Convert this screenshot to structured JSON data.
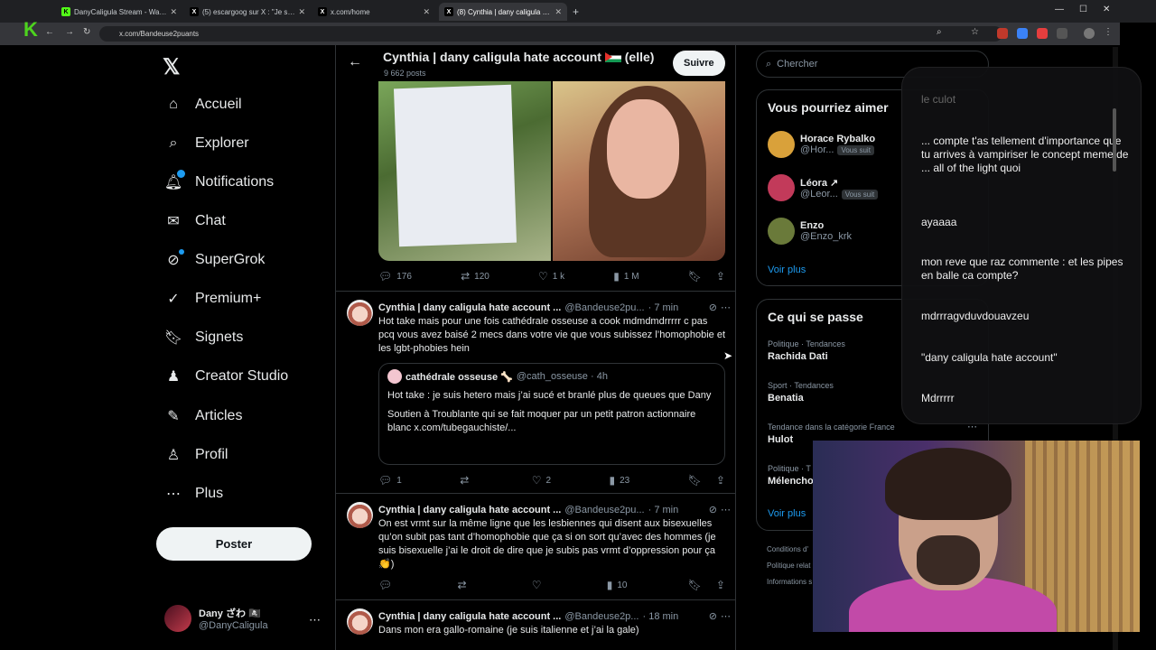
{
  "tabs": [
    {
      "label": "DanyCaligula Stream - Watch L",
      "fav": "K",
      "fav_color": "#53fc18"
    },
    {
      "label": "(5) escargoog sur X : \"Je suis pl",
      "fav": "X",
      "fav_color": "#ffffff"
    },
    {
      "label": "x.com/home",
      "fav": "X",
      "fav_color": "#ffffff"
    },
    {
      "label": "(8) Cynthia | dany caligula hate",
      "fav": "X",
      "fav_color": "#ffffff"
    }
  ],
  "url": "x.com/Bandeuse2puants",
  "nav": {
    "items": [
      {
        "label": "Accueil",
        "icon": "home-icon"
      },
      {
        "label": "Explorer",
        "icon": "search-icon"
      },
      {
        "label": "Notifications",
        "icon": "bell-icon"
      },
      {
        "label": "Chat",
        "icon": "mail-icon"
      },
      {
        "label": "SuperGrok",
        "icon": "grok-icon"
      },
      {
        "label": "Premium+",
        "icon": "verified-icon"
      },
      {
        "label": "Signets",
        "icon": "bookmark-icon"
      },
      {
        "label": "Creator Studio",
        "icon": "creator-icon"
      },
      {
        "label": "Articles",
        "icon": "articles-icon"
      },
      {
        "label": "Profil",
        "icon": "person-icon"
      },
      {
        "label": "Plus",
        "icon": "more-icon"
      }
    ],
    "post_label": "Poster",
    "me": {
      "name": "Dany ざわ 🏴‍☠️",
      "handle": "@DanyCaligula"
    }
  },
  "header": {
    "title": "Cynthia | dany caligula hate account",
    "title_suffix": "(elle)",
    "subtitle": "9 662 posts",
    "follow_label": "Suivre"
  },
  "first_tweet_actions": {
    "replies": "176",
    "reposts": "120",
    "likes": "1 k",
    "views": "1 M"
  },
  "tweets": [
    {
      "name": "Cynthia | dany caligula hate account ...",
      "handle": "@Bandeuse2pu...",
      "time": "· 7 min",
      "text": "Hot take mais pour une fois cathédrale osseuse a cook mdmdmdrrrrr c pas pcq vous avez baisé 2 mecs dans votre vie que vous subissez l’homophobie et les lgbt-phobies hein",
      "quote": {
        "name": "cathédrale osseuse 🦴",
        "handle": "@cath_osseuse · 4h",
        "text1": "Hot take : je suis hetero mais j’ai sucé et branlé plus de queues que Dany",
        "text2": "Soutien à Troublante qui se fait moquer par un petit patron actionnaire blanc x.com/tubegauchiste/..."
      },
      "replies": "1",
      "reposts": "",
      "likes": "2",
      "views": "23"
    },
    {
      "name": "Cynthia | dany caligula hate account ...",
      "handle": "@Bandeuse2pu...",
      "time": "· 7 min",
      "text": "On est vrmt sur la même ligne que les lesbiennes qui disent aux bisexuelles qu’on subit pas tant d’homophobie que ça si on sort qu’avec des hommes (je suis bisexuelle j’ai le droit de dire que je subis pas vrmt d’oppression pour ça 👏)",
      "replies": "",
      "reposts": "",
      "likes": "",
      "views": "10"
    },
    {
      "name": "Cynthia | dany caligula hate account ...",
      "handle": "@Bandeuse2p...",
      "time": "· 18 min",
      "text": "Dans mon era gallo-romaine (je suis italienne et j’ai la gale)"
    }
  ],
  "right": {
    "search_placeholder": "Chercher",
    "suggest_title": "Vous pourriez aimer",
    "suggestions": [
      {
        "name": "Horace Rybalko",
        "handle": "@Hor...",
        "badge": "Vous suit",
        "color": "#d9a13a"
      },
      {
        "name": "Léora ↗",
        "handle": "@Leor...",
        "badge": "Vous suit",
        "color": "#c23a5a"
      },
      {
        "name": "Enzo",
        "handle": "@Enzo_krk",
        "badge": "",
        "color": "#6a7a3a"
      }
    ],
    "see_more": "Voir plus",
    "trends_title": "Ce qui se passe",
    "trends": [
      {
        "category": "Politique · Tendances",
        "title": "Rachida Dati"
      },
      {
        "category": "Sport · Tendances",
        "title": "Benatia"
      },
      {
        "category": "Tendance dans la catégorie France",
        "title": "Hulot"
      },
      {
        "category": "Politique · T",
        "title": "Mélencho"
      }
    ],
    "footer": [
      "Conditions d'",
      "Politique relat",
      "Informations s"
    ]
  },
  "chat": [
    {
      "text": "le culot",
      "dim": true
    },
    {
      "text": "... compte t'as tellement d'importance que tu arrives à vampiriser le concept meme de ... all of the light quoi",
      "dim": false
    },
    {
      "text": "ayaaaa",
      "dim": false
    },
    {
      "text": "mon reve que raz commente : et les pipes en balle ca compte?",
      "dim": false
    },
    {
      "text": "mdrrragvduvdouavzeu",
      "dim": false
    },
    {
      "text": "\"dany caligula hate account\"",
      "dim": false
    },
    {
      "text": "Mdrrrrr",
      "dim": false
    }
  ]
}
